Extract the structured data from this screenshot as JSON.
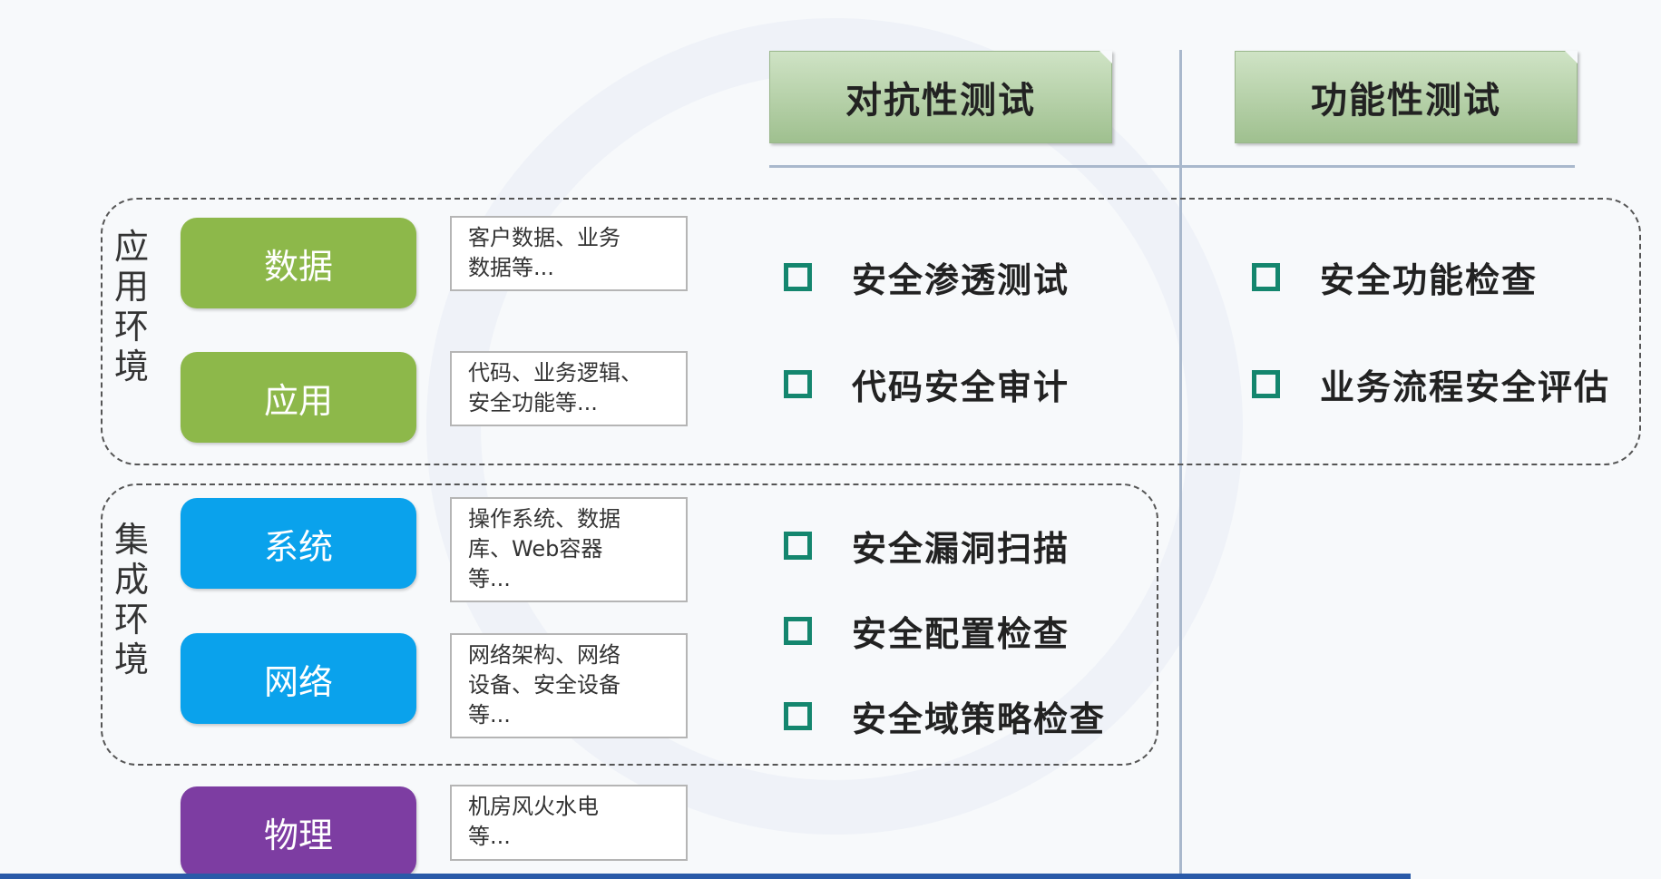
{
  "columns": {
    "adversarial": "对抗性测试",
    "functional": "功能性测试"
  },
  "groups": {
    "application": "应用环境",
    "integration": "集成环境"
  },
  "layers": [
    {
      "label": "数据",
      "color": "#8db84a",
      "desc": [
        "客户数据、业务",
        "数据等..."
      ]
    },
    {
      "label": "应用",
      "color": "#8db84a",
      "desc": [
        "代码、业务逻辑、",
        "安全功能等..."
      ]
    },
    {
      "label": "系统",
      "color": "#0aa2ec",
      "desc": [
        "操作系统、数据",
        "库、Web容器",
        "等..."
      ]
    },
    {
      "label": "网络",
      "color": "#0aa2ec",
      "desc": [
        "网络架构、网络",
        "设备、安全设备",
        "等..."
      ]
    },
    {
      "label": "物理",
      "color": "#7d3da2",
      "desc": [
        "机房风火水电",
        "等..."
      ]
    }
  ],
  "adversarial_items": [
    "安全渗透测试",
    "代码安全审计",
    "安全漏洞扫描",
    "安全配置检查",
    "安全域策略检查"
  ],
  "functional_items": [
    "安全功能检查",
    "业务流程安全评估"
  ]
}
